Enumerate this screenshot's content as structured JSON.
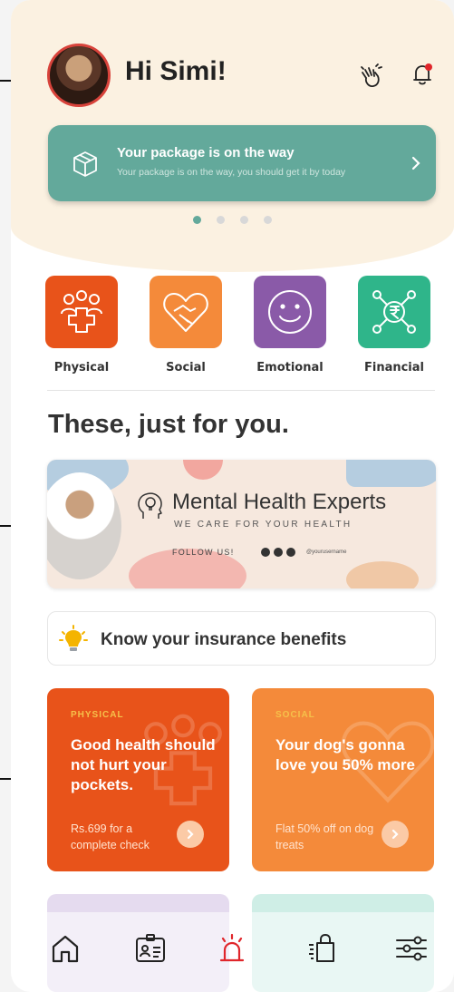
{
  "header": {
    "greeting": "Hi Simi!"
  },
  "banner_card": {
    "title": "Your package is on the way",
    "subtitle": "Your package is on the way, you should get it by today"
  },
  "carousel": {
    "count": 4,
    "active_index": 0
  },
  "categories": [
    {
      "label": "Physical",
      "color": "#e8531a"
    },
    {
      "label": "Social",
      "color": "#f48a3a"
    },
    {
      "label": "Emotional",
      "color": "#8a5aa8"
    },
    {
      "label": "Financial",
      "color": "#2fb58a"
    }
  ],
  "section": {
    "title": "These, just for you."
  },
  "promo": {
    "title": "Mental Health Experts",
    "subtitle": "WE CARE FOR YOUR HEALTH",
    "follow": "FOLLOW US!",
    "handle": "@yourusername"
  },
  "insurance": {
    "label": "Know your insurance benefits"
  },
  "offers": [
    {
      "tag": "PHYSICAL",
      "headline": "Good health should not hurt your pockets.",
      "desc": "Rs.699 for a complete check",
      "color": "#e8531a"
    },
    {
      "tag": "SOCIAL",
      "headline": "Your dog's gonna love you 50% more",
      "desc": "Flat 50% off on dog treats",
      "color": "#f48a3a"
    }
  ],
  "colors": {
    "accent_teal": "#63a99b",
    "alert_red": "#e0262b"
  },
  "nav": {
    "items": [
      "home-icon",
      "id-card-icon",
      "alarm-icon",
      "shopping-bag-icon",
      "settings-sliders-icon"
    ]
  }
}
